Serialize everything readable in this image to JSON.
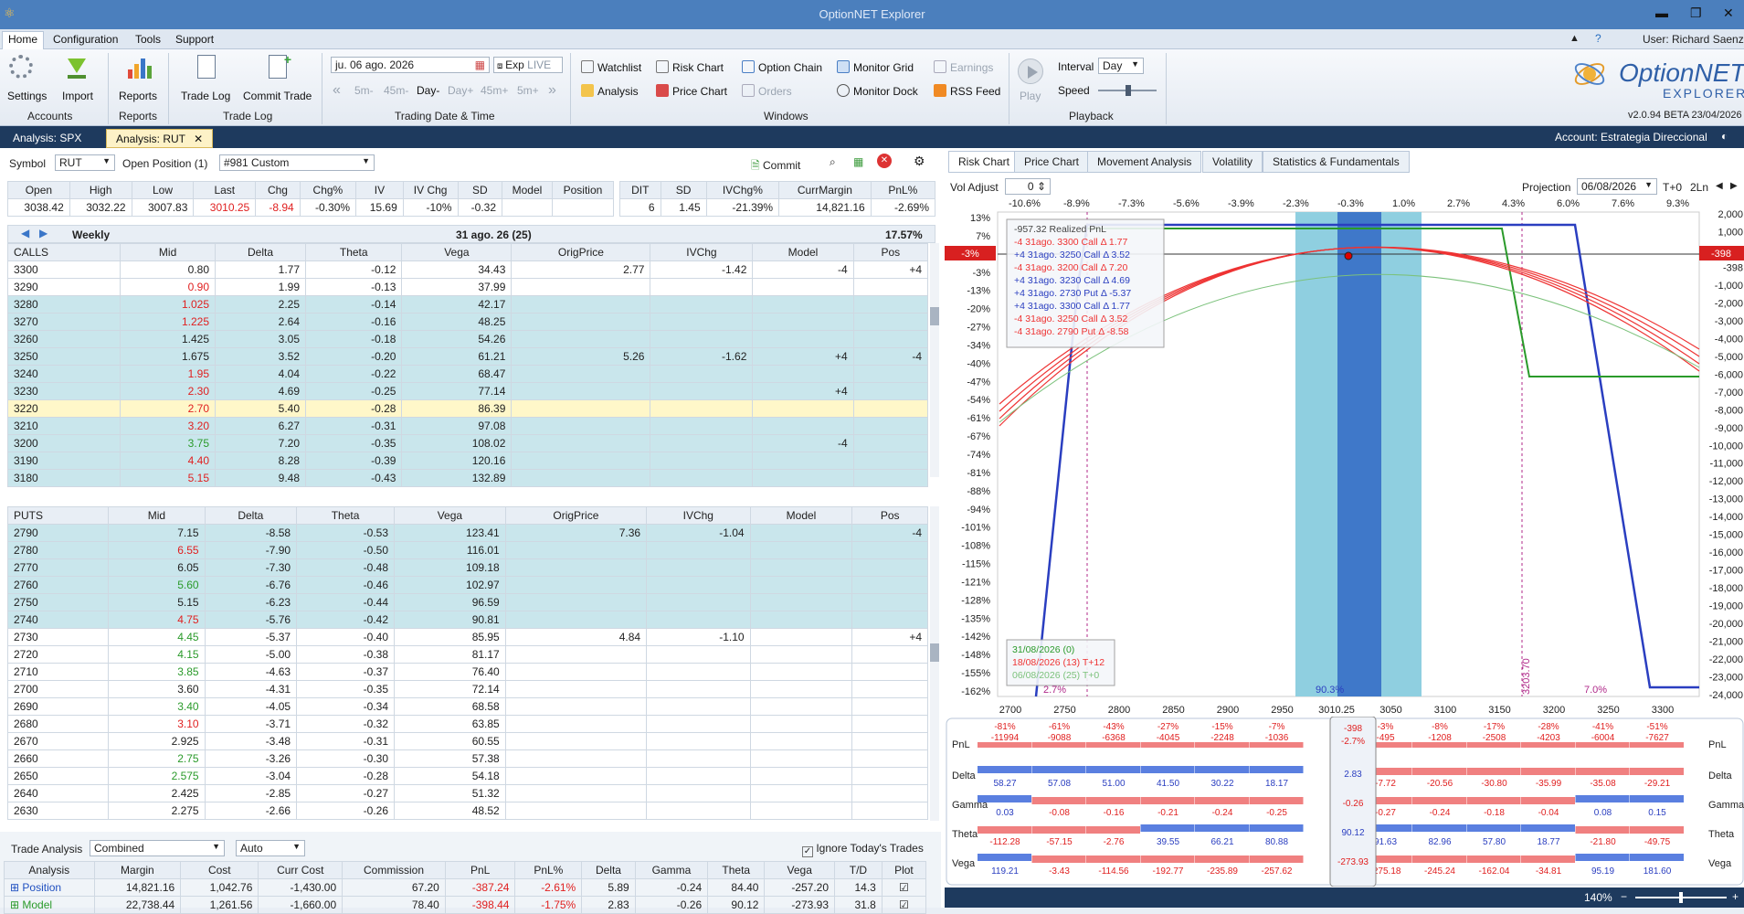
{
  "app": {
    "title": "OptionNET Explorer",
    "user": "User: Richard Saenz",
    "version": "v2.0.94 BETA 23/04/2026"
  },
  "menu": [
    "Home",
    "Configuration",
    "Tools",
    "Support"
  ],
  "ribbon": {
    "accounts": {
      "settings": "Settings",
      "import": "Import",
      "label": "Accounts"
    },
    "reports": {
      "reports": "Reports",
      "label": "Reports"
    },
    "tradelog": {
      "trade_log": "Trade Log",
      "commit_trade": "Commit Trade",
      "label": "Trade Log"
    },
    "datetime": {
      "date": "ju. 06 ago. 2026",
      "exp": "Exp",
      "live": "LIVE",
      "steps": [
        "5m-",
        "45m-",
        "Day-",
        "Day+",
        "45m+",
        "5m+"
      ],
      "label": "Trading Date & Time"
    },
    "windows": {
      "watchlist": "Watchlist",
      "risk_chart": "Risk Chart",
      "option_chain": "Option Chain",
      "monitor_grid": "Monitor Grid",
      "earnings": "Earnings",
      "analysis": "Analysis",
      "price_chart": "Price Chart",
      "orders": "Orders",
      "monitor_dock": "Monitor Dock",
      "rss_feed": "RSS Feed",
      "label": "Windows"
    },
    "playback": {
      "play": "Play",
      "interval_label": "Interval",
      "interval": "Day",
      "speed_label": "Speed",
      "label": "Playback"
    }
  },
  "tabs": [
    "Analysis: SPX",
    "Analysis: RUT"
  ],
  "account": "Account: Estrategia Direccional",
  "left": {
    "symbol_label": "Symbol",
    "symbol": "RUT",
    "open_position_label": "Open Position (1)",
    "position": "#981 Custom",
    "commit": "Commit",
    "quote_headers": [
      "Open",
      "High",
      "Low",
      "Last",
      "Chg",
      "Chg%",
      "IV",
      "IV Chg",
      "SD",
      "Model",
      "Position"
    ],
    "quote_values": [
      "3038.42",
      "3032.22",
      "3007.83",
      "3010.25",
      "-8.94",
      "-0.30%",
      "15.69",
      "-10%",
      "-0.32",
      "",
      ""
    ],
    "stat_headers": [
      "DIT",
      "SD",
      "IVChg%",
      "CurrMargin",
      "PnL%"
    ],
    "stat_values": [
      "6",
      "1.45",
      "-21.39%",
      "14,821.16",
      "-2.69%"
    ],
    "expiry": {
      "name": "Weekly",
      "date": "31 ago. 26 (25)",
      "pct": "17.57%"
    },
    "calls_headers": [
      "CALLS",
      "Mid",
      "Delta",
      "Theta",
      "Vega",
      "OrigPrice",
      "IVChg",
      "Model",
      "Pos"
    ],
    "calls": [
      [
        "3300",
        "0.80",
        "1.77",
        "-0.12",
        "34.43",
        "2.77",
        "-1.42",
        "-4",
        "+4"
      ],
      [
        "3290",
        "0.90",
        "1.99",
        "-0.13",
        "37.99",
        "",
        "",
        "",
        ""
      ],
      [
        "3280",
        "1.025",
        "2.25",
        "-0.14",
        "42.17",
        "",
        "",
        "",
        ""
      ],
      [
        "3270",
        "1.225",
        "2.64",
        "-0.16",
        "48.25",
        "",
        "",
        "",
        ""
      ],
      [
        "3260",
        "1.425",
        "3.05",
        "-0.18",
        "54.26",
        "",
        "",
        "",
        ""
      ],
      [
        "3250",
        "1.675",
        "3.52",
        "-0.20",
        "61.21",
        "5.26",
        "-1.62",
        "+4",
        "-4"
      ],
      [
        "3240",
        "1.95",
        "4.04",
        "-0.22",
        "68.47",
        "",
        "",
        "",
        ""
      ],
      [
        "3230",
        "2.30",
        "4.69",
        "-0.25",
        "77.14",
        "",
        "",
        "+4",
        ""
      ],
      [
        "3220",
        "2.70",
        "5.40",
        "-0.28",
        "86.39",
        "",
        "",
        "",
        ""
      ],
      [
        "3210",
        "3.20",
        "6.27",
        "-0.31",
        "97.08",
        "",
        "",
        "",
        ""
      ],
      [
        "3200",
        "3.75",
        "7.20",
        "-0.35",
        "108.02",
        "",
        "",
        "-4",
        ""
      ],
      [
        "3190",
        "4.40",
        "8.28",
        "-0.39",
        "120.16",
        "",
        "",
        "",
        ""
      ],
      [
        "3180",
        "5.15",
        "9.48",
        "-0.43",
        "132.89",
        "",
        "",
        "",
        ""
      ]
    ],
    "puts_headers": [
      "PUTS",
      "Mid",
      "Delta",
      "Theta",
      "Vega",
      "OrigPrice",
      "IVChg",
      "Model",
      "Pos"
    ],
    "puts": [
      [
        "2790",
        "7.15",
        "-8.58",
        "-0.53",
        "123.41",
        "7.36",
        "-1.04",
        "",
        "-4"
      ],
      [
        "2780",
        "6.55",
        "-7.90",
        "-0.50",
        "116.01",
        "",
        "",
        "",
        ""
      ],
      [
        "2770",
        "6.05",
        "-7.30",
        "-0.48",
        "109.18",
        "",
        "",
        "",
        ""
      ],
      [
        "2760",
        "5.60",
        "-6.76",
        "-0.46",
        "102.97",
        "",
        "",
        "",
        ""
      ],
      [
        "2750",
        "5.15",
        "-6.23",
        "-0.44",
        "96.59",
        "",
        "",
        "",
        ""
      ],
      [
        "2740",
        "4.75",
        "-5.76",
        "-0.42",
        "90.81",
        "",
        "",
        "",
        ""
      ],
      [
        "2730",
        "4.45",
        "-5.37",
        "-0.40",
        "85.95",
        "4.84",
        "-1.10",
        "",
        "+4"
      ],
      [
        "2720",
        "4.15",
        "-5.00",
        "-0.38",
        "81.17",
        "",
        "",
        "",
        ""
      ],
      [
        "2710",
        "3.85",
        "-4.63",
        "-0.37",
        "76.40",
        "",
        "",
        "",
        ""
      ],
      [
        "2700",
        "3.60",
        "-4.31",
        "-0.35",
        "72.14",
        "",
        "",
        "",
        ""
      ],
      [
        "2690",
        "3.40",
        "-4.05",
        "-0.34",
        "68.58",
        "",
        "",
        "",
        ""
      ],
      [
        "2680",
        "3.10",
        "-3.71",
        "-0.32",
        "63.85",
        "",
        "",
        "",
        ""
      ],
      [
        "2670",
        "2.925",
        "-3.48",
        "-0.31",
        "60.55",
        "",
        "",
        "",
        ""
      ],
      [
        "2660",
        "2.75",
        "-3.26",
        "-0.30",
        "57.38",
        "",
        "",
        "",
        ""
      ],
      [
        "2650",
        "2.575",
        "-3.04",
        "-0.28",
        "54.18",
        "",
        "",
        "",
        ""
      ],
      [
        "2640",
        "2.425",
        "-2.85",
        "-0.27",
        "51.32",
        "",
        "",
        "",
        ""
      ],
      [
        "2630",
        "2.275",
        "-2.66",
        "-0.26",
        "48.52",
        "",
        "",
        "",
        ""
      ]
    ],
    "trade_analysis": {
      "label": "Trade Analysis",
      "mode": "Combined",
      "scale": "Auto",
      "ignore": "Ignore Today's Trades",
      "headers": [
        "Analysis",
        "Margin",
        "Cost",
        "Curr Cost",
        "Commission",
        "PnL",
        "PnL%",
        "Delta",
        "Gamma",
        "Theta",
        "Vega",
        "T/D",
        "Plot"
      ],
      "rows": [
        [
          "Position",
          "14,821.16",
          "1,042.76",
          "-1,430.00",
          "67.20",
          "-387.24",
          "-2.61%",
          "5.89",
          "-0.24",
          "84.40",
          "-257.20",
          "14.3"
        ],
        [
          "Model",
          "22,738.44",
          "1,261.56",
          "-1,660.00",
          "78.40",
          "-398.44",
          "-1.75%",
          "2.83",
          "-0.26",
          "90.12",
          "-273.93",
          "31.8"
        ]
      ]
    }
  },
  "right": {
    "tabs": [
      "Risk Chart",
      "Price Chart",
      "Movement Analysis",
      "Volatility",
      "Statistics & Fundamentals"
    ],
    "vol_adjust_label": "Vol Adjust",
    "vol_adjust": "0",
    "projection_label": "Projection",
    "projection": "06/08/2026",
    "t0": "T+0",
    "lines": "2Ln",
    "top_axis": [
      "-10.6%",
      "-8.9%",
      "-7.3%",
      "-5.6%",
      "-3.9%",
      "-2.3%",
      "-0.3%",
      "1.0%",
      "2.7%",
      "4.3%",
      "6.0%",
      "7.6%",
      "9.3%"
    ],
    "left_axis": [
      "13%",
      "7%",
      "0%",
      "-3%",
      "-13%",
      "-20%",
      "-27%",
      "-34%",
      "-40%",
      "-47%",
      "-54%",
      "-61%",
      "-67%",
      "-74%",
      "-81%",
      "-88%",
      "-94%",
      "-101%",
      "-108%",
      "-115%",
      "-121%",
      "-128%",
      "-135%",
      "-142%",
      "-148%",
      "-155%",
      "-162%"
    ],
    "right_axis": [
      "2,000",
      "1,000",
      "0",
      "-398",
      "-1,000",
      "-2,000",
      "-3,000",
      "-4,000",
      "-5,000",
      "-6,000",
      "-7,000",
      "-8,000",
      "-9,000",
      "-10,000",
      "-11,000",
      "-12,000",
      "-13,000",
      "-14,000",
      "-15,000",
      "-16,000",
      "-17,000",
      "-18,000",
      "-19,000",
      "-20,000",
      "-21,000",
      "-22,000",
      "-23,000",
      "-24,000"
    ],
    "bottom_axis": [
      "2700",
      "2750",
      "2800",
      "2850",
      "2900",
      "2950",
      "3010.25",
      "3050",
      "3100",
      "3150",
      "3200",
      "3250",
      "3300"
    ],
    "legend": [
      "-957.32 Realized PnL",
      "-4 31ago. 3300 Call Δ 1.77",
      "+4 31ago. 3250 Call Δ 3.52",
      "-4 31ago. 3200 Call Δ 7.20",
      "+4 31ago. 3230 Call Δ 4.69",
      "+4 31ago. 2730 Put Δ -5.37",
      "+4 31ago. 3300 Call Δ 1.77",
      "-4 31ago. 3250 Call Δ 3.52",
      "-4 31ago. 2790 Put Δ -8.58"
    ],
    "dates_legend": [
      "31/08/2026 (0)",
      "18/08/2026 (13) T+12",
      "06/08/2026 (25) T+0"
    ],
    "marks": {
      "left_pct": "2.7%",
      "mid_pct": "90.3%",
      "right_pct": "7.0%",
      "line_label": "3203.70",
      "pnl_badge_left": "-3%",
      "pnl_badge_right": "-398"
    },
    "greeks_labels": [
      "PnL",
      "Delta",
      "Gamma",
      "Theta",
      "Vega"
    ],
    "greeks": {
      "pnl_pct": [
        "-81%",
        "-61%",
        "-43%",
        "-27%",
        "-15%",
        "-7%",
        "",
        "-3%",
        "-8%",
        "-17%",
        "-28%",
        "-41%",
        "-51%"
      ],
      "pnl": [
        "-11994",
        "-9088",
        "-6368",
        "-4045",
        "-2248",
        "-1036",
        "",
        "-495",
        "-1208",
        "-2508",
        "-4203",
        "-6004",
        "-7627"
      ],
      "delta": [
        "58.27",
        "57.08",
        "51.00",
        "41.50",
        "30.22",
        "18.17",
        "",
        "-7.72",
        "-20.56",
        "-30.80",
        "-35.99",
        "-35.08",
        "-29.21"
      ],
      "gamma": [
        "0.03",
        "-0.08",
        "-0.16",
        "-0.21",
        "-0.24",
        "-0.25",
        "",
        "-0.27",
        "-0.24",
        "-0.18",
        "-0.04",
        "0.08",
        "0.15"
      ],
      "theta": [
        "-112.28",
        "-57.15",
        "-2.76",
        "39.55",
        "66.21",
        "80.88",
        "",
        "91.63",
        "82.96",
        "57.80",
        "18.77",
        "-21.80",
        "-49.75"
      ],
      "vega": [
        "119.21",
        "-3.43",
        "-114.56",
        "-192.77",
        "-235.89",
        "-257.62",
        "",
        "-275.18",
        "-245.24",
        "-162.04",
        "-34.81",
        "95.19",
        "181.60"
      ],
      "center": {
        "pnl": "-398",
        "pnl_pct": "-2.7%",
        "delta": "2.83",
        "gamma": "-0.26",
        "theta": "90.12",
        "vega": "-273.93"
      }
    },
    "zoom": "140%"
  },
  "colors": {
    "red": "#e02020",
    "green": "#2a9a2a",
    "blue": "#2a3ec0",
    "cyan_row": "#c9e6ec",
    "nav": "#1e3a5e"
  }
}
